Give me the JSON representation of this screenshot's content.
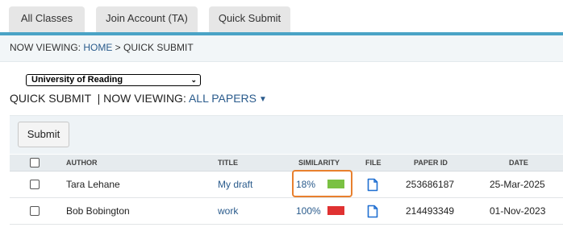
{
  "tabs": [
    {
      "label": "All Classes"
    },
    {
      "label": "Join Account (TA)"
    },
    {
      "label": "Quick Submit"
    }
  ],
  "breadcrumb": {
    "prefix": "NOW VIEWING: ",
    "home": "HOME",
    "separator": " > ",
    "current": "QUICK SUBMIT"
  },
  "institution_select": {
    "selected": "University of Reading"
  },
  "view_line": {
    "label": "QUICK SUBMIT  | NOW VIEWING: ",
    "filter": "ALL PAPERS"
  },
  "actions": {
    "submit_label": "Submit"
  },
  "table": {
    "columns": {
      "author": "AUTHOR",
      "title": "TITLE",
      "similarity": "SIMILARITY",
      "file": "FILE",
      "paper_id": "PAPER ID",
      "date": "DATE"
    },
    "rows": [
      {
        "author": "Tara Lehane",
        "title": "My draft",
        "similarity": "18%",
        "similarity_color": "#7ac143",
        "file_icon": "document-icon",
        "paper_id": "253686187",
        "date": "25-Mar-2025",
        "checked": false
      },
      {
        "author": "Bob Bobington",
        "title": "work",
        "similarity": "100%",
        "similarity_color": "#e03232",
        "file_icon": "document-icon",
        "paper_id": "214493349",
        "date": "01-Nov-2023",
        "checked": false
      }
    ]
  },
  "colors": {
    "accent_bar": "#4aa3c6",
    "link": "#2a5b8c",
    "highlight": "#e8802e"
  }
}
